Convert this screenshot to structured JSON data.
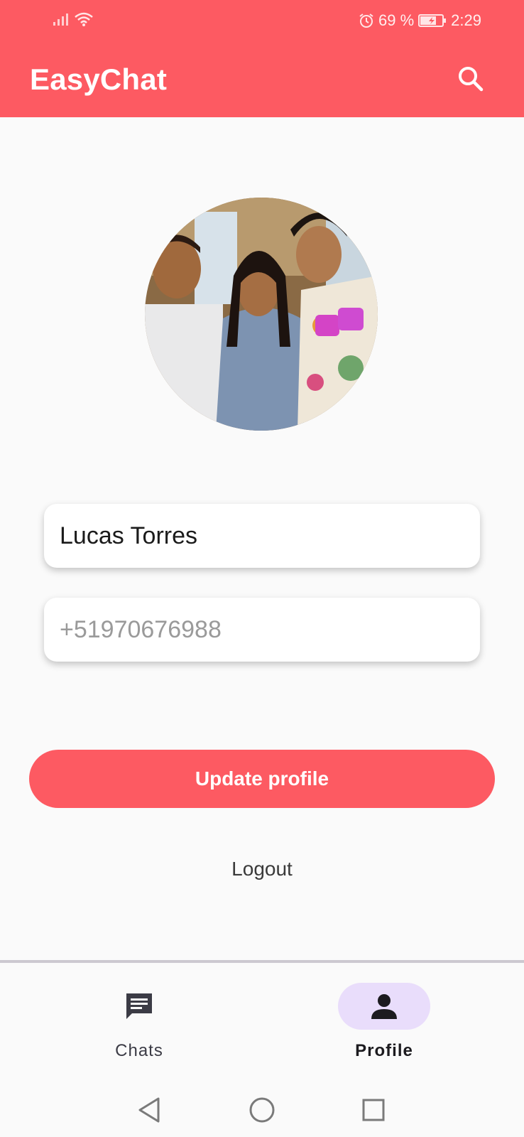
{
  "status_bar": {
    "battery_percent": "69 %",
    "time": "2:29",
    "icons": [
      "signal-icon",
      "wifi-icon",
      "alarm-icon",
      "battery-charging-icon"
    ]
  },
  "app_bar": {
    "title": "EasyChat",
    "search_icon": "search-icon"
  },
  "profile": {
    "name_value": "Lucas Torres",
    "phone_placeholder": "+51970676988",
    "update_label": "Update profile",
    "logout_label": "Logout"
  },
  "bottom_nav": {
    "items": [
      {
        "label": "Chats",
        "icon": "chat-icon",
        "active": false
      },
      {
        "label": "Profile",
        "icon": "person-icon",
        "active": true
      }
    ]
  },
  "system_nav": {
    "icons": [
      "back-icon",
      "home-icon",
      "recents-icon"
    ]
  },
  "colors": {
    "primary": "#fd5a62",
    "nav_active_pill": "#e9ddfb",
    "background": "#fafafa"
  }
}
